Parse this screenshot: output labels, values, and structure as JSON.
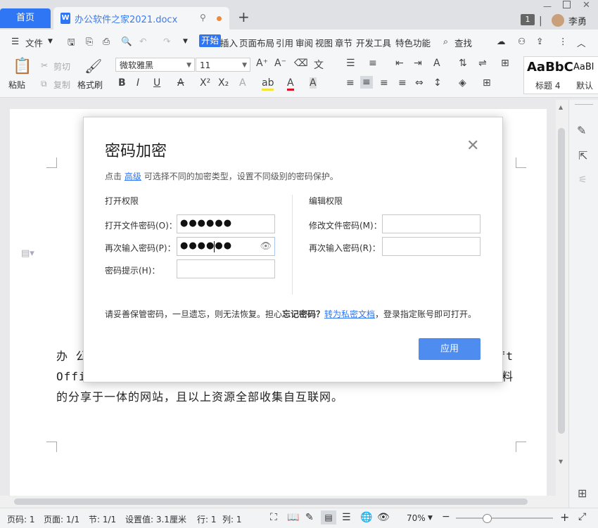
{
  "tabs": {
    "home": "首页",
    "doc_title": "办公软件之家2021.docx",
    "new_tab": "+",
    "badge": "1",
    "user": "李勇"
  },
  "menu": {
    "file": "文件",
    "items": [
      "开始",
      "插入",
      "页面布局",
      "引用",
      "审阅",
      "视图",
      "章节",
      "开发工具",
      "特色功能"
    ],
    "search": "查找"
  },
  "ribbon": {
    "paste": "粘贴",
    "cut": "剪切",
    "copy": "复制",
    "format_painter": "格式刷",
    "font_name": "微软雅黑",
    "font_size": "11",
    "style_preview_1": "AaBbC",
    "style_preview_2": "AaBl",
    "style_label_1": "标题 4",
    "style_label_2": "默认"
  },
  "document": {
    "line1_start": "办 公",
    "line1_end": "ft",
    "line2_start": "Offi",
    "line2_end": "料",
    "line3": "的分享于一体的网站，且以上资源全部收集自互联网。"
  },
  "dialog": {
    "title": "密码加密",
    "close": "✕",
    "hint_prefix": "点击",
    "hint_link": "高级",
    "hint_suffix": "可选择不同的加密类型，设置不同级别的密码保护。",
    "open_section": "打开权限",
    "edit_section": "编辑权限",
    "open_pwd_label": "打开文件密码(O)：",
    "open_pwd_value": "●●●●●●",
    "reenter_label": "再次输入密码(P)：",
    "reenter_value": "●●●●●●",
    "hint_field_label": "密码提示(H)：",
    "hint_field_value": "",
    "modify_pwd_label": "修改文件密码(M)：",
    "modify_pwd_value": "",
    "modify_reenter_label": "再次输入密码(R)：",
    "modify_reenter_value": "",
    "warn_prefix": "请妥善保管密码，一旦遗忘，则无法恢复。担心",
    "warn_bold": "忘记密码？",
    "warn_link": "转为私密文档",
    "warn_suffix": "，登录指定账号即可打开。",
    "apply": "应用"
  },
  "status": {
    "page_no": "页码: 1",
    "page": "页面: 1/1",
    "section": "节: 1/1",
    "setting": "设置值: 3.1厘米",
    "row": "行: 1",
    "col": "列: 1",
    "zoom": "70%"
  },
  "colors": {
    "accent": "#2f76f4",
    "apply_button": "#4f8cf0"
  }
}
